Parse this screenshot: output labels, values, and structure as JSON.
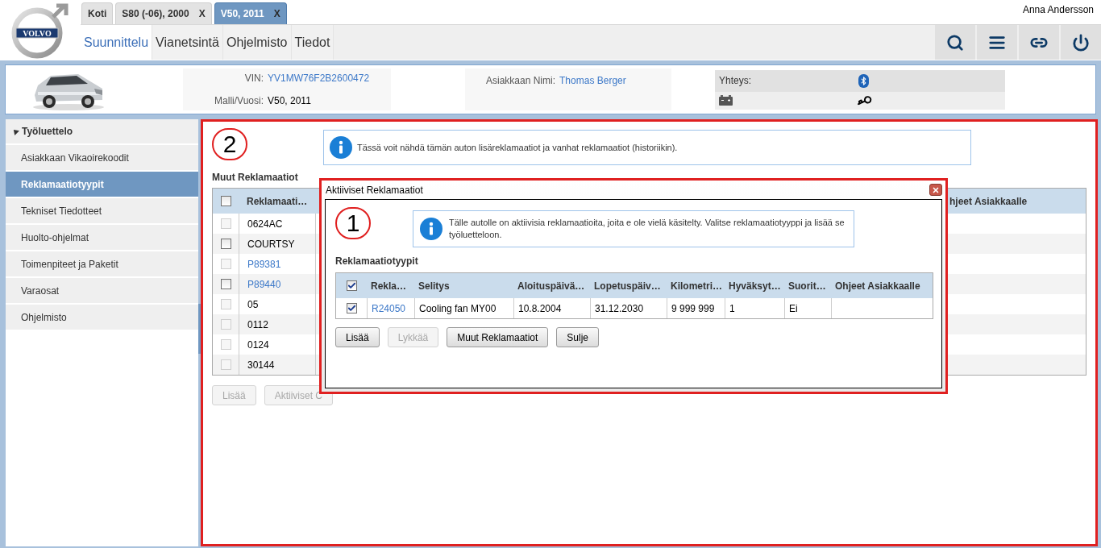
{
  "logo": {
    "text": "VOLVO"
  },
  "user": "Anna Andersson",
  "tabs": [
    {
      "label": "Koti",
      "selected": false
    },
    {
      "label": "S80 (-06), 2000",
      "close": "X",
      "selected": false
    },
    {
      "label": "V50, 2011",
      "close": "X",
      "selected": true
    }
  ],
  "nav": [
    {
      "label": "Suunnittelu",
      "selected": true
    },
    {
      "label": "Vianetsintä",
      "selected": false
    },
    {
      "label": "Ohjelmisto",
      "selected": false
    },
    {
      "label": "Tiedot",
      "selected": false
    }
  ],
  "toolbar": [
    {
      "kind": "search"
    },
    {
      "kind": "menu"
    },
    {
      "kind": "link"
    },
    {
      "kind": "power"
    }
  ],
  "vehicle": {
    "vin_label": "VIN:",
    "vin": "YV1MW76F2B2600472",
    "model_label": "Malli/Vuosi:",
    "model": "V50, 2011",
    "customer_label": "Asiakkaan Nimi:",
    "customer": "Thomas Berger",
    "connection_label": "Yhteys:"
  },
  "sidebar": {
    "title": "Työluettelo",
    "expanded": true,
    "items": [
      {
        "label": "Asiakkaan Vikaoirekoodit",
        "selected": false
      },
      {
        "label": "Reklamaatiotyypit",
        "selected": true
      },
      {
        "label": "Tekniset Tiedotteet",
        "selected": false
      },
      {
        "label": "Huolto-ohjelmat",
        "selected": false
      },
      {
        "label": "Toimenpiteet ja Paketit",
        "selected": false
      },
      {
        "label": "Varaosat",
        "selected": false
      },
      {
        "label": "Ohjelmisto",
        "selected": false
      }
    ]
  },
  "main": {
    "marker": "2",
    "info": "Tässä voit nähdä tämän auton lisäreklamaatiot ja vanhat reklamaatiot (historiikin).",
    "section_title": "Muut Reklamaatiot",
    "table": {
      "columns": [
        "Reklamaati…",
        "hjeet Asiakkaalle"
      ],
      "header_checkbox_disabled": false,
      "rows": [
        {
          "code": "0624AC",
          "link": false,
          "disabled": true
        },
        {
          "code": "COURTSY",
          "link": false,
          "disabled": false
        },
        {
          "code": "P89381",
          "link": true,
          "disabled": true
        },
        {
          "code": "P89440",
          "link": true,
          "disabled": false
        },
        {
          "code": "05",
          "link": false,
          "disabled": true
        },
        {
          "code": "0112",
          "link": false,
          "disabled": true
        },
        {
          "code": "0124",
          "link": false,
          "disabled": true
        },
        {
          "code": "30144",
          "link": false,
          "disabled": true
        }
      ]
    },
    "buttons": [
      {
        "label": "Lisää",
        "disabled": true
      },
      {
        "label": "Aktiiviset C",
        "disabled": true
      }
    ]
  },
  "dialog": {
    "title": "Aktiiviset Reklamaatiot",
    "marker": "1",
    "info": "Tälle autolle on aktiivisia reklamaatioita, joita e ole vielä käsitelty. Valitse reklamaatiotyyppi ja lisää se työluetteloon.",
    "section_title": "Reklamaatiotyypit",
    "table": {
      "header_checked": true,
      "columns": [
        "Rekla…",
        "Selitys",
        "Aloituspäivä…",
        "Lopetuspäiv…",
        "Kilometri…",
        "Hyväksyt…",
        "Suorit…",
        "Ohjeet Asiakkaalle"
      ],
      "rows": [
        {
          "checked": true,
          "cells": [
            "R24050",
            "Cooling fan MY00",
            "10.8.2004",
            "31.12.2030",
            "9 999 999",
            "1",
            "Ei",
            null
          ]
        }
      ]
    },
    "buttons": [
      {
        "label": "Lisää",
        "disabled": false
      },
      {
        "label": "Lykkää",
        "disabled": true
      },
      {
        "label": "Muut Reklamaatiot",
        "disabled": false
      },
      {
        "label": "Sulje",
        "disabled": false
      }
    ]
  }
}
